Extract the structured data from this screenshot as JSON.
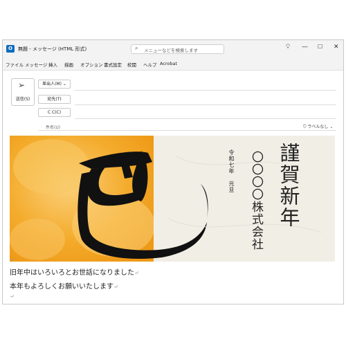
{
  "window": {
    "app_icon_letter": "O",
    "title": "無題 - メッセージ (HTML 形式)",
    "search_placeholder": "メニューなどを検索します"
  },
  "ribbon": {
    "items": [
      "ファイル",
      "メッセージ",
      "挿入",
      "描画",
      "オプション",
      "書式設定",
      "校閲",
      "ヘルプ",
      "Acrobat"
    ]
  },
  "compose": {
    "send_label": "送信(S)",
    "from_label": "差出人(M)",
    "to_label": "宛先(T)",
    "cc_label": "C C(C)",
    "subject_label": "件名(U)",
    "sensitivity_label": "ラベルなし"
  },
  "card": {
    "greeting_chars": "謹賀新年",
    "company": "〇〇〇〇株式会社",
    "date_line": "令和七年　元旦",
    "zodiac_char": "巳"
  },
  "body": {
    "line1": "旧年中はいろいろとお世話になりました",
    "line2": "本年もよろしくお願いいたします"
  },
  "colors": {
    "accent": "#0f6cbd",
    "orange": "#f2a724",
    "paper": "#f1eee6"
  }
}
